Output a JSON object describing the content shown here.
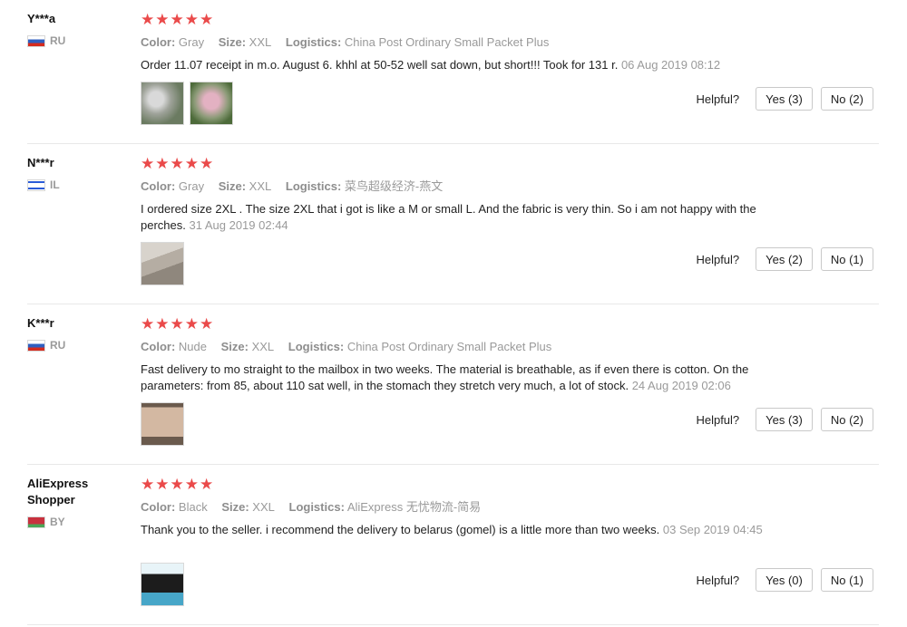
{
  "reviews": [
    {
      "user": "Y***a",
      "country": "RU",
      "stars": "★★★★★",
      "color_label": "Color:",
      "color": "Gray",
      "size_label": "Size:",
      "size": "XXL",
      "logistics_label": "Logistics:",
      "logistics": "China Post Ordinary Small Packet Plus",
      "text": "Order 11.07 receipt in m.o. August 6. khhl at 50-52 well sat down, but short!!! Took for 131 r.",
      "date": "06 Aug 2019 08:12",
      "helpful_label": "Helpful?",
      "yes": "Yes (3)",
      "no": "No (2)"
    },
    {
      "user": "N***r",
      "country": "IL",
      "stars": "★★★★★",
      "color_label": "Color:",
      "color": "Gray",
      "size_label": "Size:",
      "size": "XXL",
      "logistics_label": "Logistics:",
      "logistics": "菜鸟超级经济-燕文",
      "text": "I ordered size 2XL . The size 2XL that i got is like a M or small L. And the fabric is very thin. So i am not happy with the perches.",
      "date": "31 Aug 2019 02:44",
      "helpful_label": "Helpful?",
      "yes": "Yes (2)",
      "no": "No (1)"
    },
    {
      "user": "K***r",
      "country": "RU",
      "stars": "★★★★★",
      "color_label": "Color:",
      "color": "Nude",
      "size_label": "Size:",
      "size": "XXL",
      "logistics_label": "Logistics:",
      "logistics": "China Post Ordinary Small Packet Plus",
      "text": "Fast delivery to mo straight to the mailbox in two weeks. The material is breathable, as if even there is cotton. On the parameters: from 85, about 110 sat well, in the stomach they stretch very much, a lot of stock.",
      "date": "24 Aug 2019 02:06",
      "helpful_label": "Helpful?",
      "yes": "Yes (3)",
      "no": "No (2)"
    },
    {
      "user": "AliExpress Shopper",
      "country": "BY",
      "stars": "★★★★★",
      "color_label": "Color:",
      "color": "Black",
      "size_label": "Size:",
      "size": "XXL",
      "logistics_label": "Logistics:",
      "logistics": "AliExpress 无忧物流-简易",
      "text": "Thank you to the seller. i recommend the delivery to belarus (gomel) is a little more than two weeks.",
      "date": "03 Sep 2019 04:45",
      "helpful_label": "Helpful?",
      "yes": "Yes (0)",
      "no": "No (1)"
    }
  ],
  "colors": {
    "star": "#ea4a4a",
    "meta_text": "#9a9a9a",
    "border": "#e8e8e8"
  }
}
